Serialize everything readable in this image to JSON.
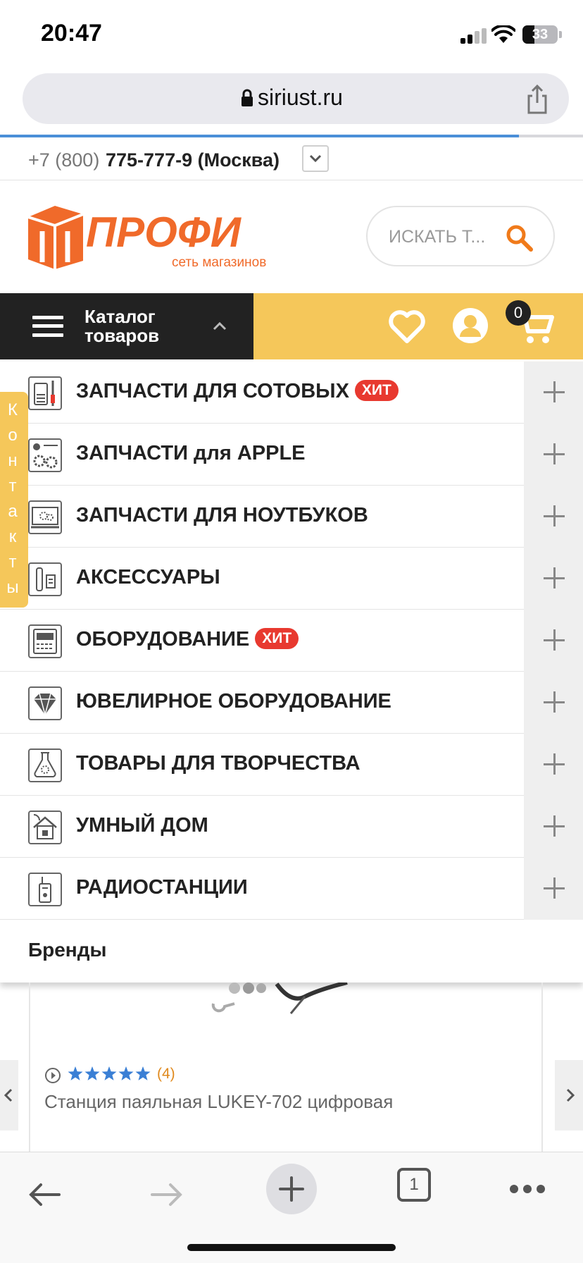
{
  "status_bar": {
    "time": "20:47",
    "battery_level": "33",
    "icons": [
      "cellular-signal-icon",
      "wifi-icon",
      "battery-icon"
    ]
  },
  "browser": {
    "url": "siriust.ru",
    "lock_icon": "lock-icon",
    "share_icon": "share-icon",
    "load_progress": 0.89
  },
  "phone": {
    "prefix": "+7 (800)",
    "main": "775-777-9 (Москва)"
  },
  "header": {
    "logo_text": "ПРОФИ",
    "logo_tagline": "сеть магазинов",
    "search_placeholder": "ИСКАТЬ Т...",
    "brand_color": "#f06a2a"
  },
  "nav": {
    "catalog_label": "Каталог товаров",
    "cart_count": "0",
    "accent_color": "#f5c75a"
  },
  "contacts_tab": [
    "К",
    "о",
    "н",
    "т",
    "а",
    "к",
    "т",
    "ы"
  ],
  "menu": {
    "items": [
      {
        "label": "ЗАПЧАСТИ ДЛЯ СОТОВЫХ",
        "badge": "ХИТ",
        "icon": "phone-parts-icon"
      },
      {
        "label": "ЗАПЧАСТИ для APPLE",
        "badge": "",
        "icon": "apple-parts-icon"
      },
      {
        "label": "ЗАПЧАСТИ ДЛЯ НОУТБУКОВ",
        "badge": "",
        "icon": "laptop-parts-icon"
      },
      {
        "label": "АКСЕССУАРЫ",
        "badge": "",
        "icon": "accessories-icon"
      },
      {
        "label": "ОБОРУДОВАНИЕ",
        "badge": "ХИТ",
        "icon": "equipment-icon"
      },
      {
        "label": "ЮВЕЛИРНОЕ ОБОРУДОВАНИЕ",
        "badge": "",
        "icon": "diamond-icon"
      },
      {
        "label": "ТОВАРЫ ДЛЯ ТВОРЧЕСТВА",
        "badge": "",
        "icon": "crafts-icon"
      },
      {
        "label": "УМНЫЙ ДОМ",
        "badge": "",
        "icon": "smart-home-icon"
      },
      {
        "label": "РАДИОСТАНЦИИ",
        "badge": "",
        "icon": "radio-icon"
      }
    ],
    "brands_label": "Бренды"
  },
  "product": {
    "rating": 5,
    "review_count": "(4)",
    "name": "Станция паяльная LUKEY-702 цифровая",
    "star_color": "#3a7fd5"
  },
  "toolbar": {
    "tab_count": "1"
  }
}
